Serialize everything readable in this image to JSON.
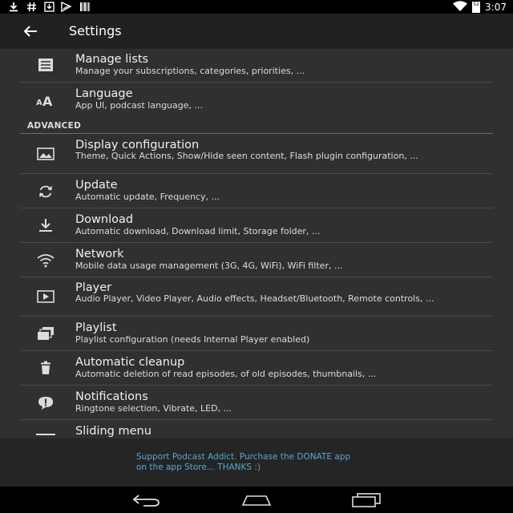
{
  "status_bar": {
    "left_icons": [
      "download-icon",
      "hash-icon",
      "inbox-download-icon",
      "podcast-icon",
      "barcode-icon"
    ],
    "time": "3:07",
    "battery_level": "52"
  },
  "app_bar": {
    "title": "Settings"
  },
  "items_top": [
    {
      "id": "manage-lists",
      "icon": "list-icon",
      "title": "Manage lists",
      "subtitle": "Manage your subscriptions, categories, priorities, ..."
    },
    {
      "id": "language",
      "icon": "font-size-icon",
      "title": "Language",
      "subtitle": "App UI, podcast language, ..."
    }
  ],
  "section_header": "ADVANCED",
  "items_advanced": [
    {
      "id": "display-configuration",
      "icon": "image-icon",
      "title": "Display configuration",
      "subtitle": "Theme, Quick Actions, Show/Hide seen content, Flash plugin configuration, ..."
    },
    {
      "id": "update",
      "icon": "refresh-icon",
      "title": "Update",
      "subtitle": "Automatic update, Frequency, ..."
    },
    {
      "id": "download",
      "icon": "download-icon",
      "title": "Download",
      "subtitle": "Automatic download, Download limit, Storage folder, ..."
    },
    {
      "id": "network",
      "icon": "wifi-icon",
      "title": "Network",
      "subtitle": "Mobile data usage management (3G, 4G, WiFi), WiFi filter, ..."
    },
    {
      "id": "player",
      "icon": "play-box-icon",
      "title": "Player",
      "subtitle": "Audio Player, Video Player, Audio effects, Headset/Bluetooth, Remote controls, ..."
    },
    {
      "id": "playlist",
      "icon": "playlist-icon",
      "title": "Playlist",
      "subtitle": "Playlist configuration (needs Internal Player enabled)"
    },
    {
      "id": "automatic-cleanup",
      "icon": "trash-icon",
      "title": "Automatic cleanup",
      "subtitle": "Automatic deletion of read episodes, of old episodes, thumbnails, ..."
    },
    {
      "id": "notifications",
      "icon": "alert-bubble-icon",
      "title": "Notifications",
      "subtitle": "Ringtone selection, Vibrate, LED, ..."
    },
    {
      "id": "sliding-menu",
      "icon": "menu-icon",
      "title": "Sliding menu",
      "subtitle": ""
    }
  ],
  "footer": {
    "text_line1": "Support Podcast Addict. Purchase the DONATE app",
    "text_line2": "on the app Store... THANKS :)"
  },
  "nav_bar": {
    "buttons": [
      "back-nav-icon",
      "home-nav-icon",
      "recents-nav-icon"
    ]
  }
}
